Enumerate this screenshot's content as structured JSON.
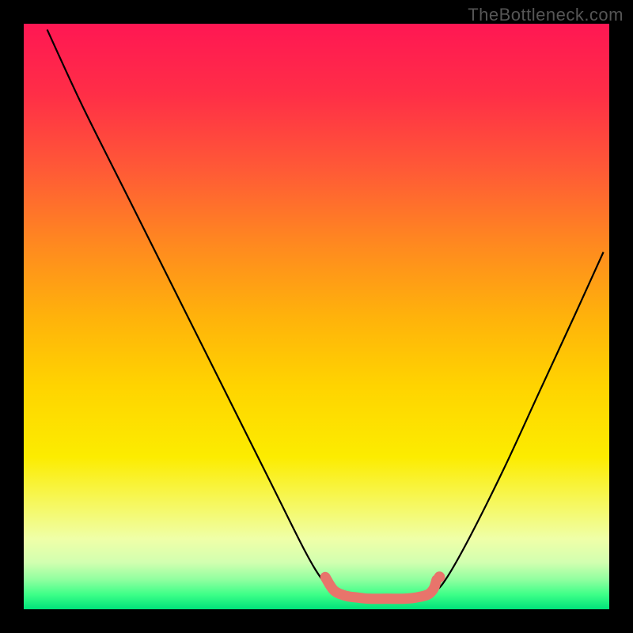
{
  "watermark": "TheBottleneck.com",
  "chart_data": {
    "type": "line",
    "title": "",
    "xlabel": "",
    "ylabel": "",
    "xlim": [
      0,
      100
    ],
    "ylim": [
      0,
      100
    ],
    "grid": false,
    "legend": false,
    "series": [
      {
        "name": "bottleneck-curve",
        "color": "#000000",
        "points": [
          {
            "x": 4,
            "y": 99
          },
          {
            "x": 10,
            "y": 86
          },
          {
            "x": 18,
            "y": 70
          },
          {
            "x": 26,
            "y": 54
          },
          {
            "x": 34,
            "y": 38
          },
          {
            "x": 42,
            "y": 22
          },
          {
            "x": 48,
            "y": 10
          },
          {
            "x": 51,
            "y": 5
          },
          {
            "x": 53,
            "y": 3
          },
          {
            "x": 57,
            "y": 2
          },
          {
            "x": 62,
            "y": 2
          },
          {
            "x": 67,
            "y": 2
          },
          {
            "x": 70,
            "y": 3
          },
          {
            "x": 72,
            "y": 5
          },
          {
            "x": 76,
            "y": 12
          },
          {
            "x": 82,
            "y": 24
          },
          {
            "x": 88,
            "y": 37
          },
          {
            "x": 94,
            "y": 50
          },
          {
            "x": 99,
            "y": 61
          }
        ]
      }
    ],
    "highlight_zone": {
      "name": "optimal-range",
      "color": "#e8746b",
      "points": [
        {
          "x": 51.5,
          "y": 5.5
        },
        {
          "x": 53,
          "y": 3.2
        },
        {
          "x": 55,
          "y": 2.3
        },
        {
          "x": 57,
          "y": 2.0
        },
        {
          "x": 59,
          "y": 1.8
        },
        {
          "x": 62,
          "y": 1.8
        },
        {
          "x": 65,
          "y": 1.8
        },
        {
          "x": 67,
          "y": 2.0
        },
        {
          "x": 69,
          "y": 2.5
        },
        {
          "x": 70,
          "y": 3.5
        },
        {
          "x": 70.5,
          "y": 5.0
        }
      ],
      "marker_point": {
        "x": 71,
        "y": 5.5
      }
    },
    "background_gradient": [
      {
        "offset": 0.0,
        "color": "#ff1753"
      },
      {
        "offset": 0.12,
        "color": "#ff2e47"
      },
      {
        "offset": 0.25,
        "color": "#ff5a36"
      },
      {
        "offset": 0.38,
        "color": "#ff8a1f"
      },
      {
        "offset": 0.5,
        "color": "#ffb20b"
      },
      {
        "offset": 0.62,
        "color": "#ffd400"
      },
      {
        "offset": 0.74,
        "color": "#fcec00"
      },
      {
        "offset": 0.83,
        "color": "#f5f96b"
      },
      {
        "offset": 0.88,
        "color": "#efffa8"
      },
      {
        "offset": 0.92,
        "color": "#d2ffb0"
      },
      {
        "offset": 0.95,
        "color": "#8eff9f"
      },
      {
        "offset": 0.975,
        "color": "#3dff88"
      },
      {
        "offset": 1.0,
        "color": "#00e27a"
      }
    ]
  }
}
